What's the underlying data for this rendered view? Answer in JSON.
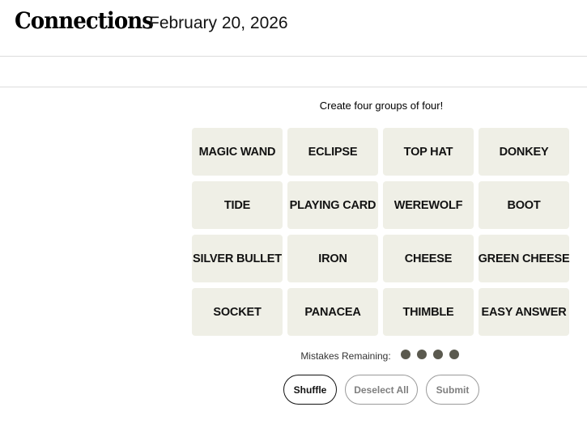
{
  "header": {
    "title": "Connections",
    "date": "February 20, 2026"
  },
  "game": {
    "instructions": "Create four groups of four!",
    "tiles": [
      "MAGIC WAND",
      "ECLIPSE",
      "TOP HAT",
      "DONKEY",
      "TIDE",
      "PLAYING CARD",
      "WEREWOLF",
      "BOOT",
      "SILVER BULLET",
      "IRON",
      "CHEESE",
      "GREEN CHEESE",
      "SOCKET",
      "PANACEA",
      "THIMBLE",
      "EASY ANSWER"
    ],
    "mistakes_label": "Mistakes Remaining:",
    "mistakes_remaining": 4,
    "dot_color": "#5a594e",
    "tile_color": "#efefe6"
  },
  "controls": {
    "shuffle_label": "Shuffle",
    "deselect_label": "Deselect All",
    "submit_label": "Submit"
  }
}
